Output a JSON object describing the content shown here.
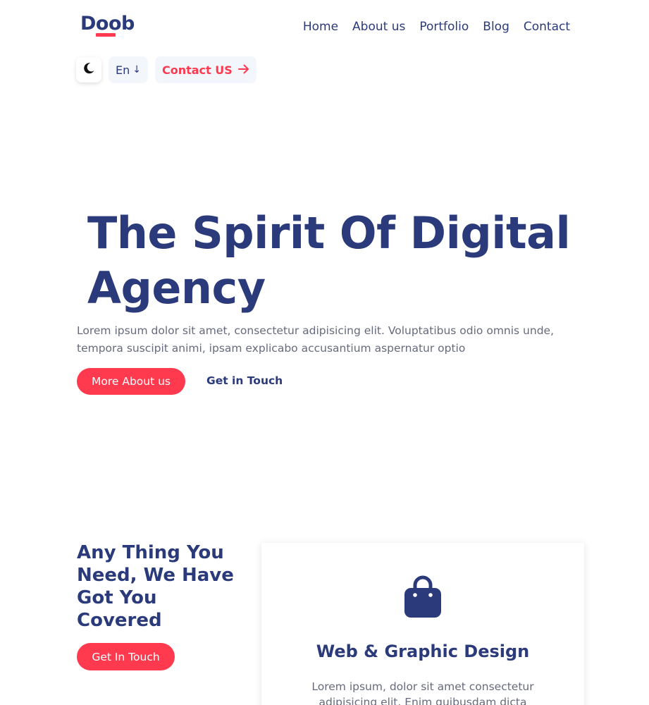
{
  "header": {
    "logo": "Doob",
    "nav": [
      {
        "label": "Home"
      },
      {
        "label": "About us"
      },
      {
        "label": "Portfolio"
      },
      {
        "label": "Blog"
      },
      {
        "label": "Contact"
      }
    ],
    "tools": {
      "moon_icon": "moon-icon",
      "language": "En",
      "language_arrow": "↓",
      "contact_label": "Contact US",
      "contact_icon": "arrow-right-icon"
    }
  },
  "hero": {
    "title_line1": "The Spirit Of Digital",
    "title_line2": "Agency",
    "text": "Lorem ipsum dolor sit amet, consectetur adipisicing elit. Voluptatibus odio omnis unde, tempora suscipit animi, ipsam explicabo accusantium aspernatur optio",
    "primary_button": "More About us",
    "secondary_link": "Get in Touch"
  },
  "services": {
    "title": "Any Thing You Need, We Have Got You Covered",
    "button": "Get In Touch",
    "card": {
      "icon": "shopping-bag-icon",
      "title": "Web & Graphic Design",
      "text": "Lorem ipsum, dolor sit amet consectetur adipisicing elit. Enim quibusdam dicta"
    }
  },
  "colors": {
    "primary_text": "#2b3a7a",
    "accent": "#ff3a4e",
    "body_text": "#666a7c",
    "chip_background": "#f3f6fb"
  }
}
